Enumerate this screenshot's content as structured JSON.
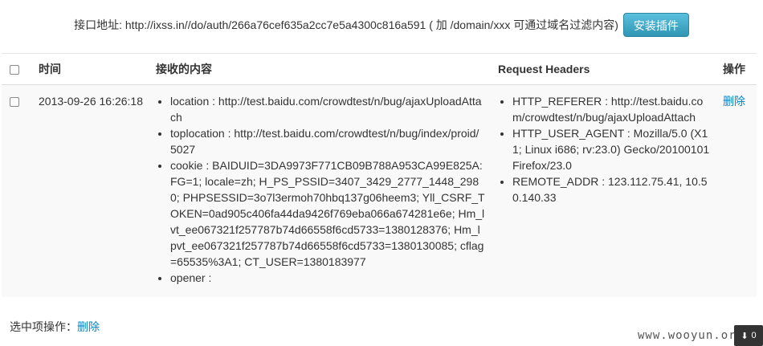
{
  "header": {
    "api_label": "接口地址: http://ixss.in//do/auth/266a76cef635a2cc7e5a4300c816a591 ( 加 /domain/xxx 可通过域名过滤内容)",
    "install_button": "安装插件"
  },
  "table": {
    "columns": [
      "时间",
      "接收的内容",
      "Request Headers",
      "操作"
    ],
    "rows": [
      {
        "time": "2013-09-26 16:26:18",
        "content": [
          "location : http://test.baidu.com/crowdtest/n/bug/ajaxUploadAttach",
          "toplocation : http://test.baidu.com/crowdtest/n/bug/index/proid/5027",
          "cookie : BAIDUID=3DA9973F771CB09B788A953CA99E825A:FG=1; locale=zh; H_PS_PSSID=3407_3429_2777_1448_2980; PHPSESSID=3o7l3ermoh70hbq137g06heem3; Yll_CSRF_TOKEN=0ad905c406fa44da9426f769eba066a674281e6e; Hm_lvt_ee067321f257787b74d66558f6cd5733=1380128376; Hm_lpvt_ee067321f257787b74d66558f6cd5733=1380130085; cflag=65535%3A1; CT_USER=1380183977",
          "opener :"
        ],
        "headers": [
          "HTTP_REFERER : http://test.baidu.com/crowdtest/n/bug/ajaxUploadAttach",
          "HTTP_USER_AGENT : Mozilla/5.0 (X11; Linux i686; rv:23.0) Gecko/20100101 Firefox/23.0",
          "REMOTE_ADDR : 123.112.75.41, 10.50.140.33"
        ],
        "action": "删除"
      }
    ]
  },
  "footer": {
    "selected_label": "选中项操作：",
    "delete_link": "删除"
  },
  "watermark": "www.wooyun.org",
  "corner_widget": {
    "arrow": "⬇",
    "count": "0"
  }
}
